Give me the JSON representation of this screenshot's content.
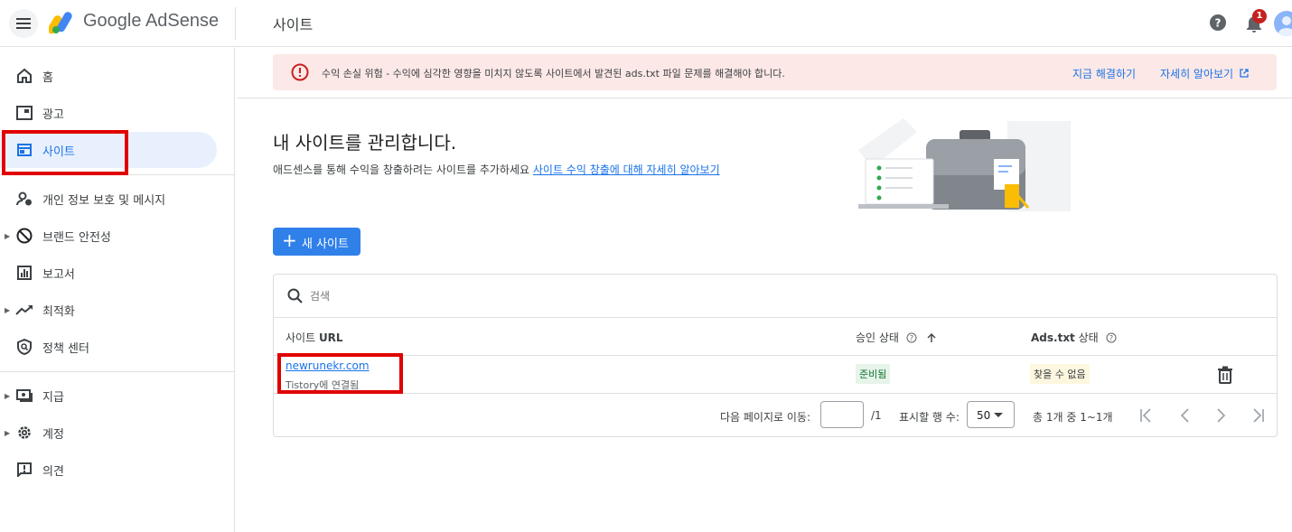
{
  "header": {
    "app_name": "Google AdSense",
    "page_title": "사이트",
    "notification_count": "1"
  },
  "sidebar": {
    "items": [
      {
        "label": "홈",
        "icon": "home-icon"
      },
      {
        "label": "광고",
        "icon": "ads-icon"
      },
      {
        "label": "사이트",
        "icon": "sites-icon"
      },
      {
        "label": "개인 정보 보호 및 메시지",
        "icon": "privacy-icon"
      },
      {
        "label": "브랜드 안전성",
        "icon": "block-icon"
      },
      {
        "label": "보고서",
        "icon": "reports-icon"
      },
      {
        "label": "최적화",
        "icon": "trending-icon"
      },
      {
        "label": "정책 센터",
        "icon": "policy-icon"
      },
      {
        "label": "지급",
        "icon": "payments-icon"
      },
      {
        "label": "계정",
        "icon": "gear-icon"
      },
      {
        "label": "의견",
        "icon": "feedback-icon"
      }
    ]
  },
  "alert": {
    "text": "수익 손실 위험 - 수익에 심각한 영향을 미치지 않도록 사이트에서 발견된 ads.txt 파일 문제를 해결해야 합니다.",
    "fix_now": "지금 해결하기",
    "learn_more": "자세히 알아보기"
  },
  "hero": {
    "title": "내 사이트를 관리합니다.",
    "description": "애드센스를 통해 수익을 창출하려는 사이트를 추가하세요 ",
    "link": "사이트 수익 창출에 대해 자세히 알아보기"
  },
  "new_site_button": "새 사이트",
  "search": {
    "placeholder": "검색"
  },
  "table": {
    "headers": {
      "site_url_prefix": "사이트 ",
      "site_url_bold": "URL",
      "approval": "승인 상태",
      "ads_txt_bold": "Ads.txt",
      "ads_txt_suffix": " 상태"
    },
    "rows": [
      {
        "url": "newrunekr.com",
        "sub": "Tistory에 연결됨",
        "approval": "준비됨",
        "ads_txt": "찾을 수 없음"
      }
    ]
  },
  "pagination": {
    "goto_label": "다음 페이지로 이동:",
    "page_total": "/1",
    "rows_label": "표시할 행 수:",
    "rows_value": "50",
    "range": "총 1개 중 1~1개"
  },
  "colors": {
    "accent": "#1a73e8",
    "highlight_box": "#e00000",
    "alert_bg": "#fce8e6"
  }
}
